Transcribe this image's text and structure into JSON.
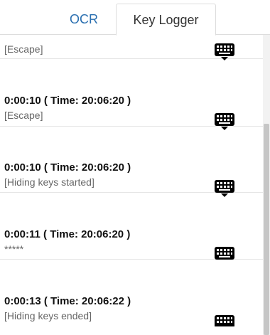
{
  "tabs": [
    {
      "label": "OCR",
      "active": false
    },
    {
      "label": "Key Logger",
      "active": true
    }
  ],
  "entries": [
    {
      "time": "",
      "detail": "[Escape]"
    },
    {
      "time": "0:00:10 ( Time: 20:06:20 )",
      "detail": "[Escape]"
    },
    {
      "time": "0:00:10 ( Time: 20:06:20 )",
      "detail": "[Hiding keys started]"
    },
    {
      "time": "0:00:11 ( Time: 20:06:20 )",
      "detail": "*****"
    },
    {
      "time": "0:00:13 ( Time: 20:06:22 )",
      "detail": "[Hiding keys ended]"
    }
  ],
  "icons": {
    "keyboard": "keyboard-icon"
  },
  "colors": {
    "active_tab_text": "#333333",
    "inactive_tab_text": "#2a6fb0",
    "detail_text": "#666666"
  }
}
